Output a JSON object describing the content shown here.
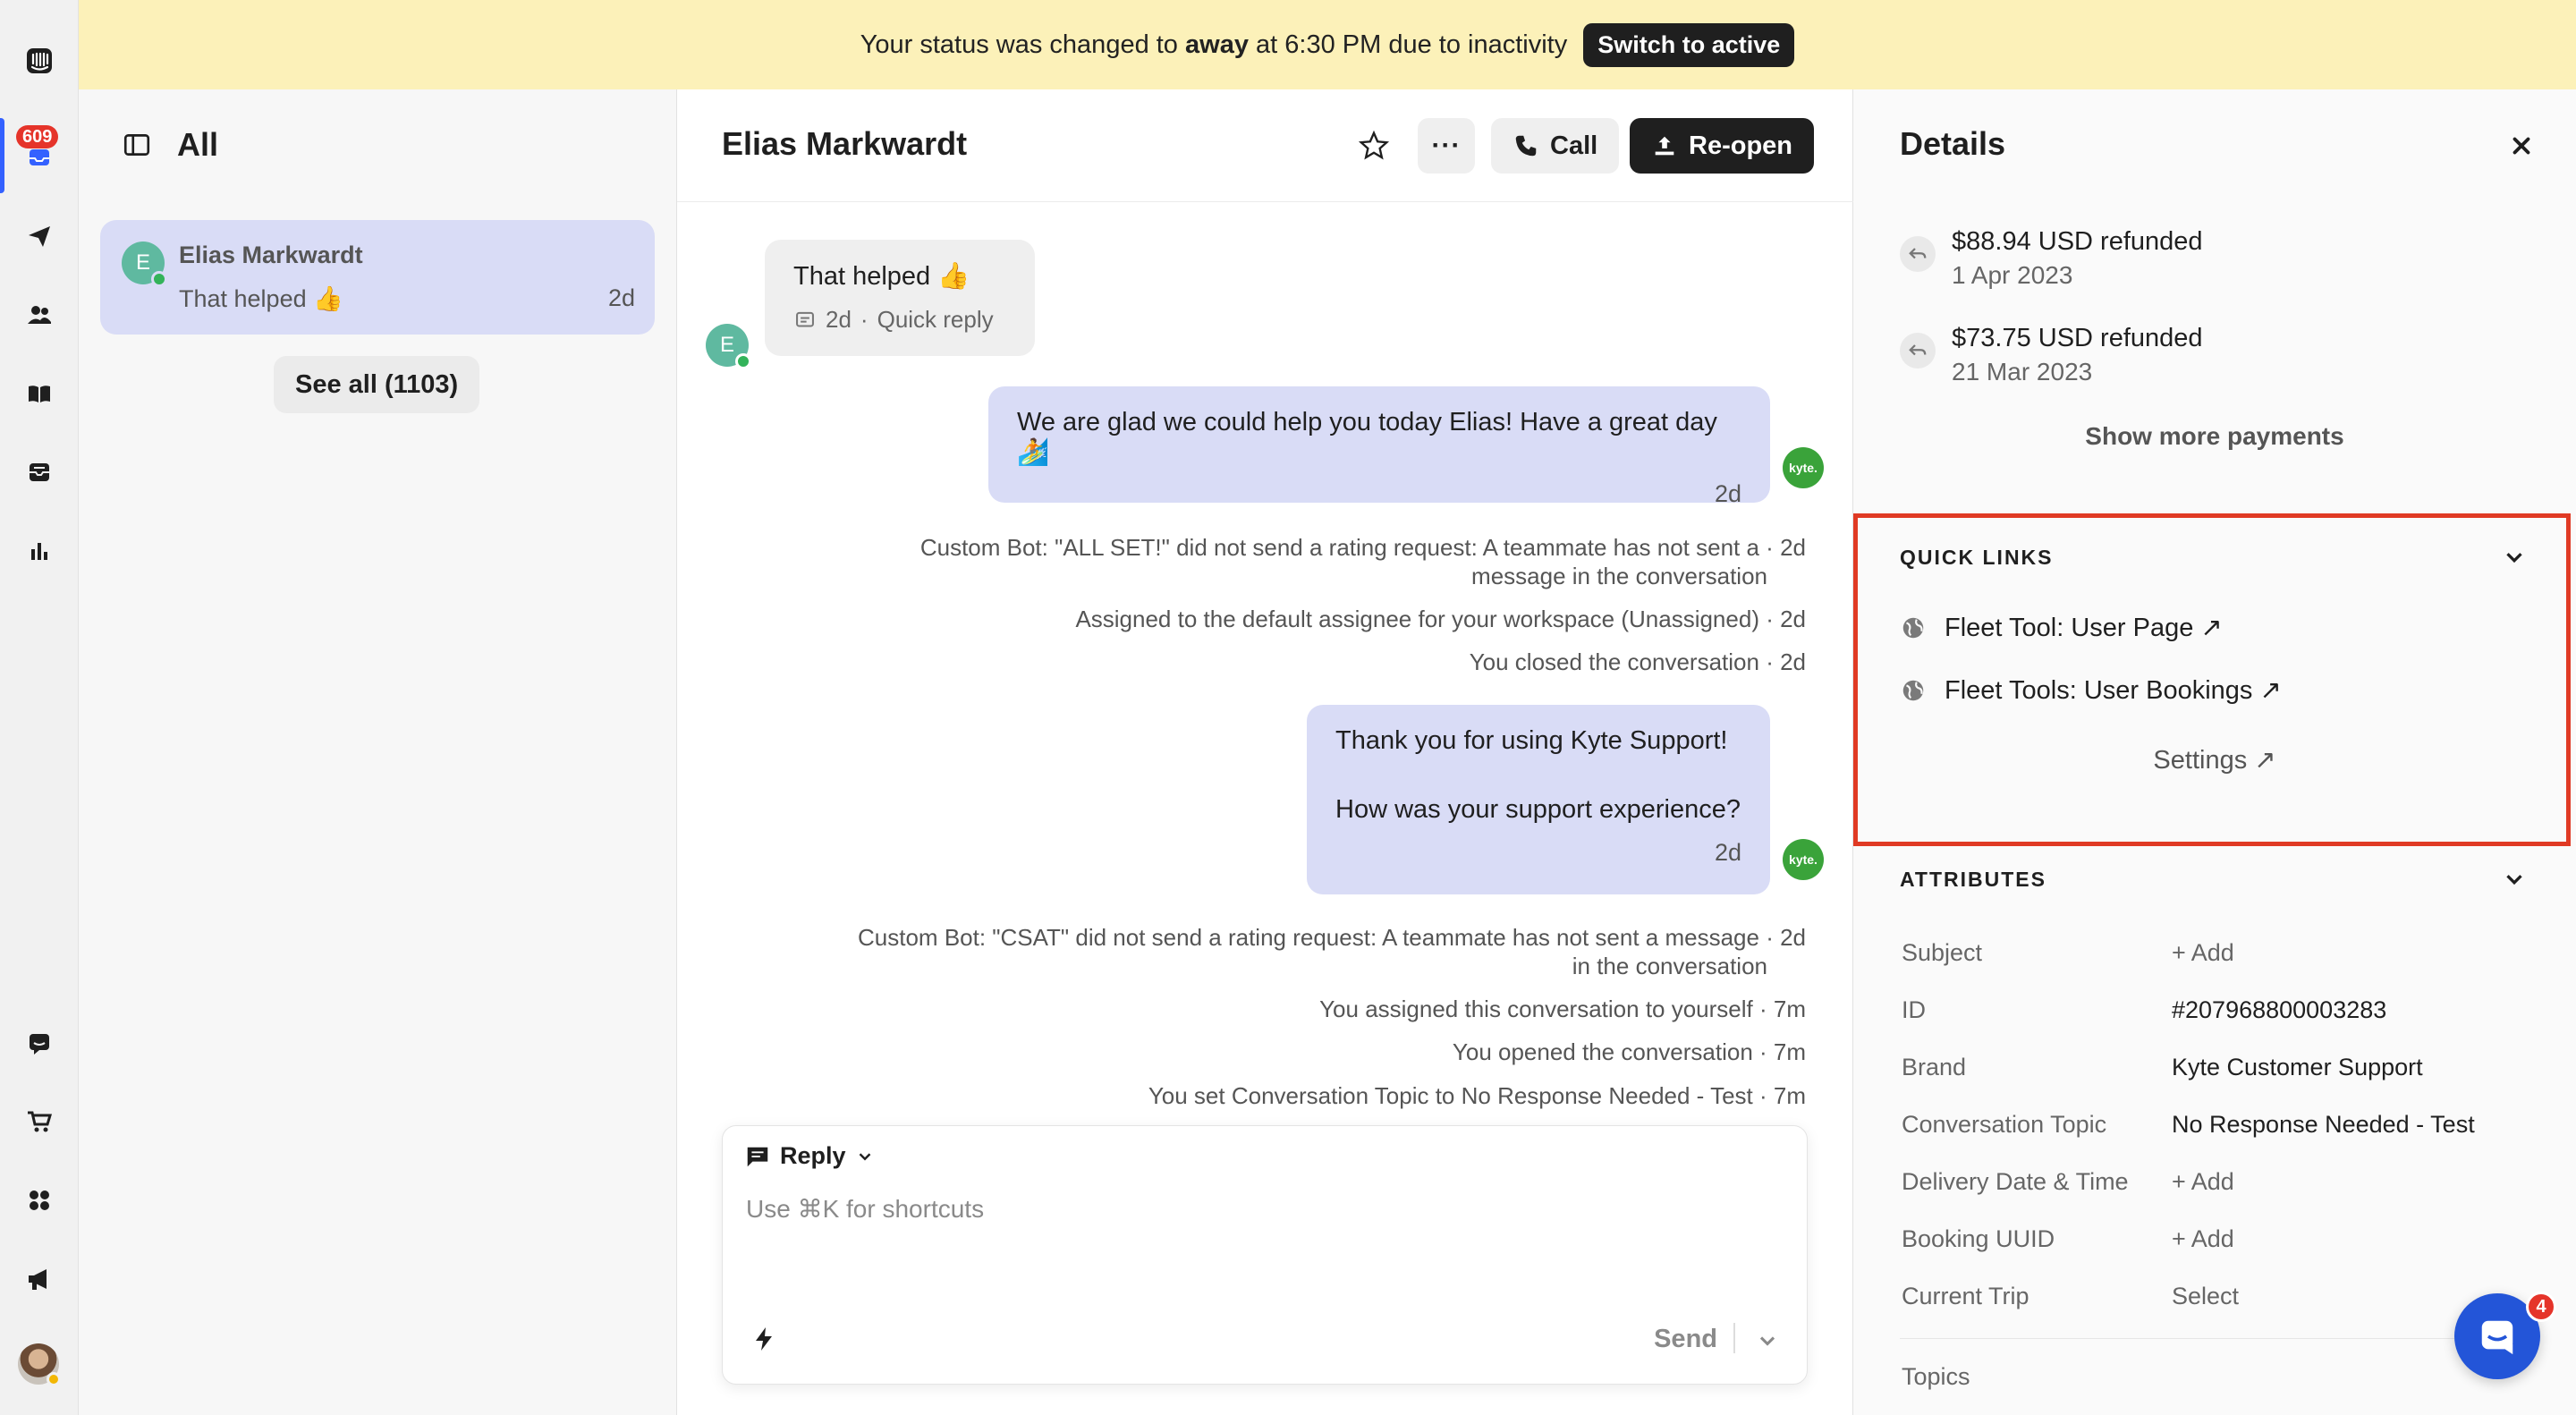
{
  "banner": {
    "text_before": "Your status was changed to",
    "status": "away",
    "text_after": "at 6:30 PM due to inactivity",
    "button": "Switch to active",
    "bg_color": "#fcf1b9"
  },
  "rail": {
    "inbox_badge": "609",
    "icons": [
      "intercom-logo-icon",
      "inbox-icon",
      "outbound-icon",
      "contacts-icon",
      "knowledge-icon",
      "reports-inbox-icon",
      "reports-icon",
      "messenger-icon",
      "shop-icon",
      "apps-icon",
      "announce-icon",
      "avatar"
    ],
    "accent": "#3461ff"
  },
  "list": {
    "title": "All",
    "conversation": {
      "avatar_initial": "E",
      "name": "Elias Markwardt",
      "snippet": "That helped 👍",
      "time": "2d"
    },
    "see_all": "See all (1103)"
  },
  "conversation": {
    "title": "Elias Markwardt",
    "call_label": "Call",
    "reopen_label": "Re-open",
    "more_label": "···",
    "customer_initial": "E",
    "agent_badge": "kyte.",
    "message1": {
      "text": "That helped 👍",
      "time": "2d",
      "source": "Quick reply"
    },
    "message2": {
      "text": "We are glad we could help you today Elias! Have a great day 🏄",
      "time": "2d"
    },
    "events1": [
      "Custom Bot: \"ALL SET!\" did not send a rating request: A teammate has not sent a · 2d",
      "message in the conversation",
      "Assigned to the default assignee for your workspace (Unassigned) · 2d",
      "You closed the conversation · 2d"
    ],
    "message3": {
      "line1": "Thank you for using Kyte Support!",
      "line2": "How was your support experience?",
      "time": "2d"
    },
    "events2": [
      "Custom Bot: \"CSAT\" did not send a rating request: A teammate has not sent a message · 2d",
      "in the conversation",
      "You assigned this conversation to yourself · 7m",
      "You opened the conversation · 7m",
      "You set Conversation Topic to No Response Needed - Test · 7m"
    ]
  },
  "composer": {
    "mode": "Reply",
    "placeholder": "Use ⌘K for shortcuts",
    "send": "Send"
  },
  "details": {
    "title": "Details",
    "payments": [
      {
        "amount": "$88.94 USD refunded",
        "date": "1 Apr 2023"
      },
      {
        "amount": "$73.75 USD refunded",
        "date": "21 Mar 2023"
      }
    ],
    "show_more": "Show more payments",
    "quick_links": {
      "heading": "QUICK LINKS",
      "items": [
        "Fleet Tool: User Page ↗",
        "Fleet Tools: User Bookings ↗"
      ],
      "settings": "Settings ↗",
      "highlight_color": "#e03a24"
    },
    "attributes": {
      "heading": "ATTRIBUTES",
      "rows": [
        {
          "label": "Subject",
          "value": "+ Add"
        },
        {
          "label": "ID",
          "value": "#207968800003283"
        },
        {
          "label": "Brand",
          "value": "Kyte Customer Support"
        },
        {
          "label": "Conversation Topic",
          "value": "No Response Needed - Test"
        },
        {
          "label": "Delivery Date & Time",
          "value": "+ Add"
        },
        {
          "label": "Booking UUID",
          "value": "+ Add"
        },
        {
          "label": "Current Trip",
          "value": "Select"
        }
      ],
      "topics_label": "Topics"
    }
  },
  "launcher": {
    "badge": "4"
  }
}
